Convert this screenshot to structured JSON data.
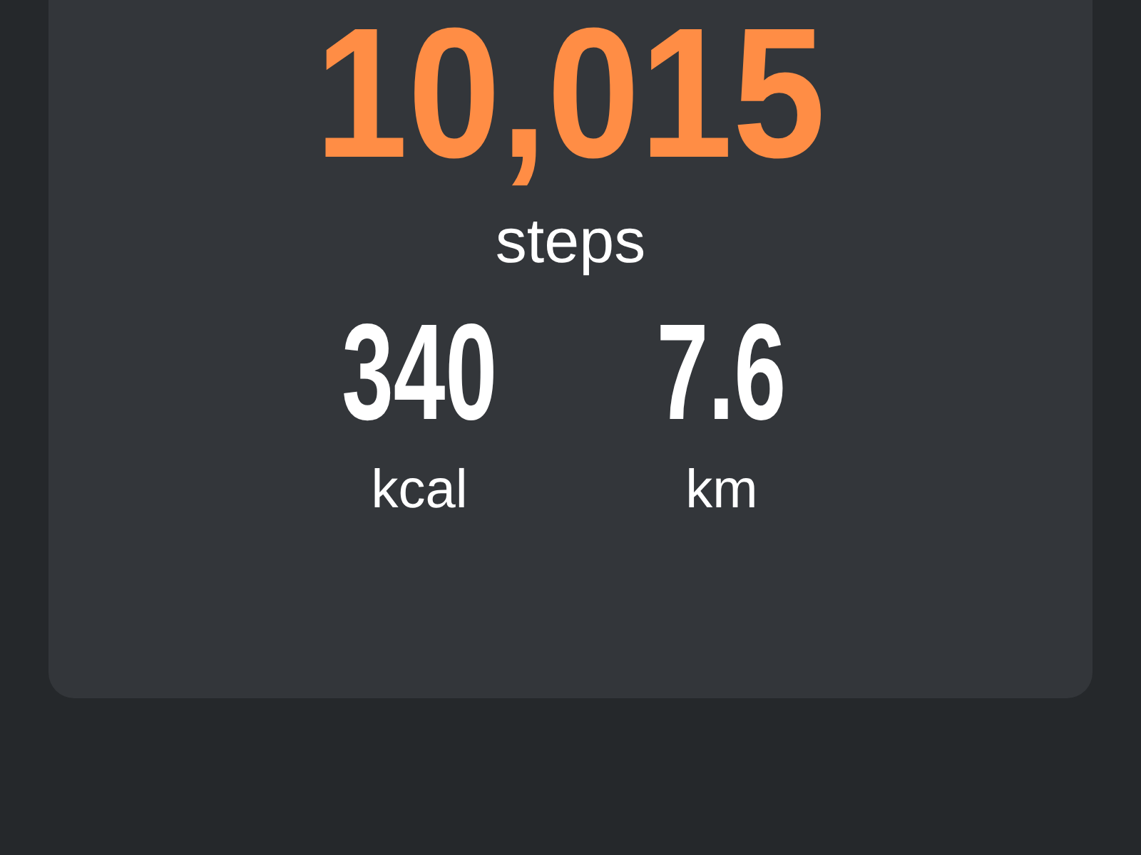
{
  "steps": {
    "value": "10,015",
    "label": "steps"
  },
  "stats": [
    {
      "value": "340",
      "unit": "kcal"
    },
    {
      "value": "7.6",
      "unit": "km"
    }
  ]
}
